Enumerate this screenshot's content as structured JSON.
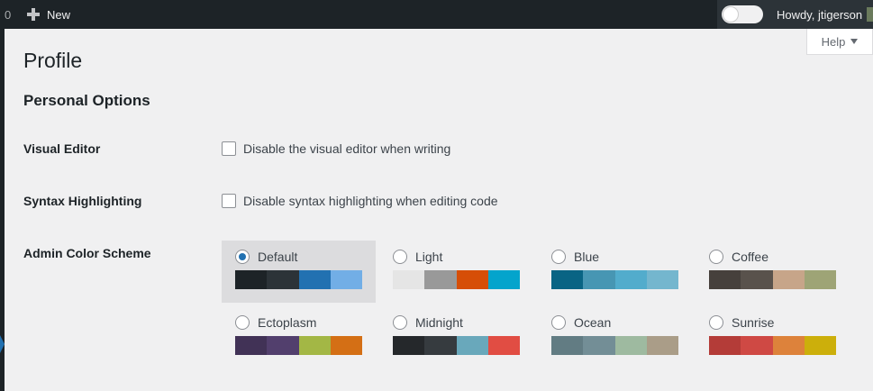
{
  "adminbar": {
    "count": "0",
    "new_label": "New",
    "howdy": "Howdy, jtigerson"
  },
  "help": {
    "label": "Help"
  },
  "page": {
    "title": "Profile",
    "section": "Personal Options"
  },
  "options": {
    "visual_editor": {
      "label": "Visual Editor",
      "checkbox_label": "Disable the visual editor when writing",
      "checked": false
    },
    "syntax": {
      "label": "Syntax Highlighting",
      "checkbox_label": "Disable syntax highlighting when editing code",
      "checked": false
    },
    "color_scheme": {
      "label": "Admin Color Scheme"
    }
  },
  "schemes": [
    {
      "name": "Default",
      "selected": true,
      "colors": [
        "#1d2327",
        "#2c3338",
        "#2271b1",
        "#72aee6"
      ]
    },
    {
      "name": "Light",
      "selected": false,
      "colors": [
        "#e5e5e5",
        "#999999",
        "#d64e07",
        "#04a4cc"
      ]
    },
    {
      "name": "Blue",
      "selected": false,
      "colors": [
        "#096484",
        "#4796b3",
        "#52accc",
        "#74b6ce"
      ]
    },
    {
      "name": "Coffee",
      "selected": false,
      "colors": [
        "#46403c",
        "#59524c",
        "#c7a589",
        "#9ea476"
      ]
    },
    {
      "name": "Ectoplasm",
      "selected": false,
      "colors": [
        "#413256",
        "#523f6d",
        "#a3b745",
        "#d46f15"
      ]
    },
    {
      "name": "Midnight",
      "selected": false,
      "colors": [
        "#25282b",
        "#363b3f",
        "#69a8bb",
        "#e14d43"
      ]
    },
    {
      "name": "Ocean",
      "selected": false,
      "colors": [
        "#627c83",
        "#738e96",
        "#9ebaa0",
        "#aa9d88"
      ]
    },
    {
      "name": "Sunrise",
      "selected": false,
      "colors": [
        "#b43c38",
        "#cf4944",
        "#dd823b",
        "#ccaf0b"
      ]
    }
  ]
}
